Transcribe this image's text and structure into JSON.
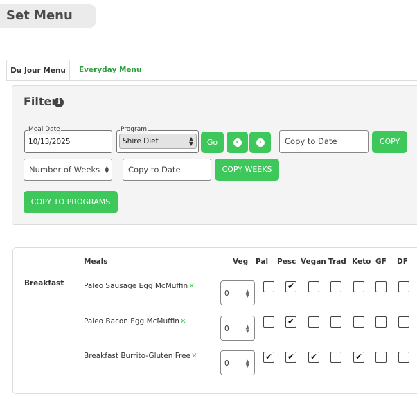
{
  "page_title": "Set Menu",
  "tabs": [
    {
      "label": "Du Jour Menu",
      "active": true
    },
    {
      "label": "Everyday Menu",
      "active": false
    }
  ],
  "filter": {
    "title": "Filter",
    "info_icon": "i",
    "meal_date": {
      "legend": "Meal Date",
      "value": "10/13/2025"
    },
    "program": {
      "legend": "Program",
      "value": "Shire Diet"
    },
    "go_label": "Go",
    "prev_icon": "‹",
    "next_icon": "›",
    "copy_to_date_placeholder": "Copy to Date",
    "copy_label": "COPY",
    "weeks_value": "Number of Weeks",
    "copy_to_date2_placeholder": "Copy to Date",
    "copy_weeks_label": "COPY WEEKS",
    "copy_programs_label": "COPY TO PROGRAMS"
  },
  "meals_table": {
    "headers": {
      "meals": "Meals",
      "veg": "Veg",
      "pal": "Pal",
      "pesc": "Pesc",
      "vegan": "Vegan",
      "trad": "Trad",
      "keto": "Keto",
      "gf": "GF",
      "df": "DF"
    },
    "section": "Breakfast",
    "rows": [
      {
        "name": "Paleo Sausage Egg McMuffin",
        "veg": "0",
        "remove": "✕",
        "checks": {
          "pal": "",
          "pesc": "✔",
          "vegan": "",
          "trad": "",
          "keto": "",
          "gf": "",
          "df": ""
        }
      },
      {
        "name": "Paleo Bacon Egg McMuffin",
        "veg": "0",
        "remove": "✕",
        "checks": {
          "pal": "",
          "pesc": "✔",
          "vegan": "",
          "trad": "",
          "keto": "",
          "gf": "",
          "df": ""
        }
      },
      {
        "name": "Breakfast Burrito-Gluten Free",
        "veg": "0",
        "remove": "✕",
        "checks": {
          "pal": "✔",
          "pesc": "✔",
          "vegan": "✔",
          "trad": "",
          "keto": "✔",
          "gf": "",
          "df": ""
        }
      }
    ]
  }
}
